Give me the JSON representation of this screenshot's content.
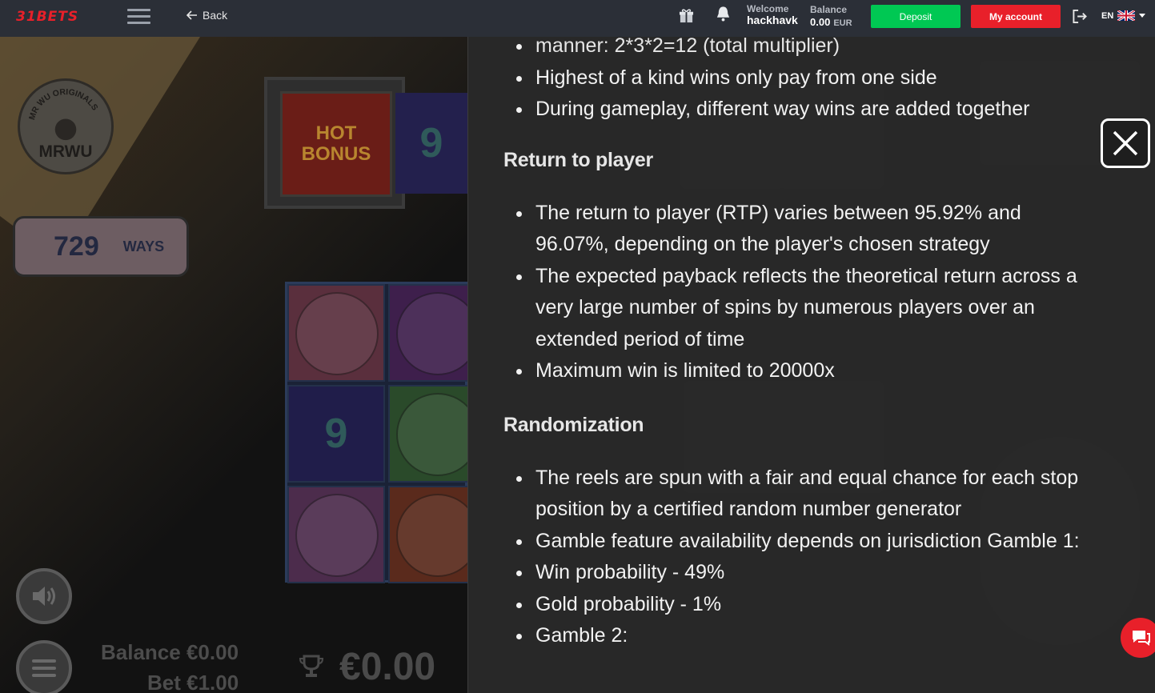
{
  "header": {
    "logo_text": "31BETS",
    "back_label": "Back",
    "welcome_label": "Welcome",
    "username": "hackhavk",
    "balance_label": "Balance",
    "balance_value": "0.00",
    "balance_currency": "EUR",
    "deposit_label": "Deposit",
    "my_account_label": "My account",
    "language": "EN",
    "colors": {
      "deposit": "#00c853",
      "my_account": "#e8202a",
      "bar": "#2b2f37"
    }
  },
  "game": {
    "brand": "MRWU",
    "brand_ring": "MR WU ORIGINALS",
    "ways_count": "729",
    "ways_label": "WAYS",
    "hot_bonus_label": "HOT BONUS",
    "symbol_nine": "9",
    "balance_label": "Balance",
    "balance_value": "€0.00",
    "bet_label": "Bet",
    "bet_value": "€1.00",
    "win_value": "€0.00"
  },
  "rules": {
    "top_items": [
      "manner: 2*3*2=12 (total multiplier)",
      "Highest of a kind wins only pay from one side",
      "During gameplay, different way wins are added together"
    ],
    "rtp": {
      "heading": "Return to player",
      "items": [
        "The return to player (RTP) varies between 95.92% and 96.07%, depending on the player's chosen strategy",
        "The expected payback reflects the theoretical return across a very large number of spins by numerous players over an extended period of time",
        "Maximum win is limited to 20000x"
      ]
    },
    "randomization": {
      "heading": "Randomization",
      "items": [
        "The reels are spun with a fair and equal chance for each stop position by a certified random number generator",
        "Gamble feature availability depends on jurisdiction Gamble 1:",
        "Win probability - 49%",
        "Gold probability - 1%",
        "Gamble 2:"
      ]
    }
  },
  "icons": [
    "gift-icon",
    "bell-icon",
    "logout-icon",
    "uk-flag-icon",
    "close-icon",
    "chat-icon",
    "sound-icon",
    "menu-icon",
    "trophy-icon"
  ]
}
